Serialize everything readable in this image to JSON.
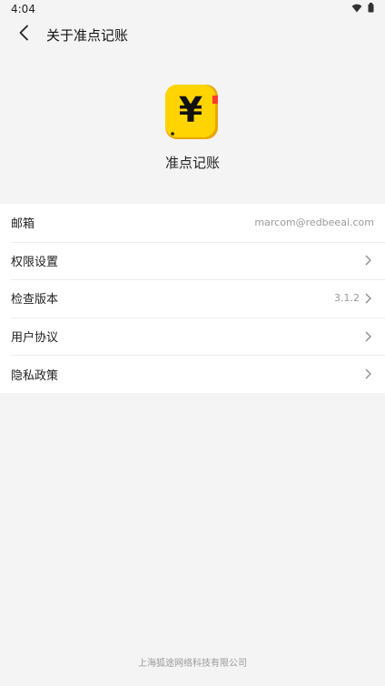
{
  "status_bar": {
    "time": "4:04"
  },
  "header": {
    "title": "关于准点记账"
  },
  "app": {
    "name": "准点记账",
    "logo_symbol": "¥"
  },
  "colors": {
    "accent": "#ffd400",
    "logo_border": "#e6a800",
    "ribbon": "#ff3b30"
  },
  "settings": {
    "items": [
      {
        "label": "邮箱",
        "value": "marcom@redbeeai.com",
        "chevron": false
      },
      {
        "label": "权限设置",
        "value": "",
        "chevron": true
      },
      {
        "label": "检查版本",
        "value": "3.1.2",
        "chevron": true
      },
      {
        "label": "用户协议",
        "value": "",
        "chevron": true
      },
      {
        "label": "隐私政策",
        "value": "",
        "chevron": true
      }
    ]
  },
  "footer": {
    "company": "上海狐途网络科技有限公司"
  }
}
